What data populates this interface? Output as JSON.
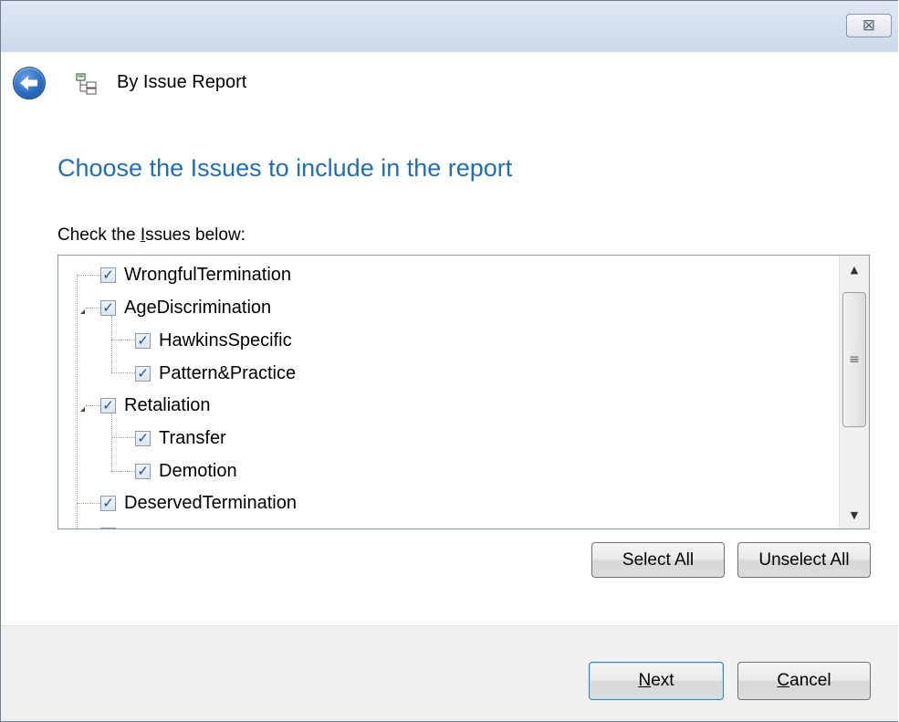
{
  "window": {
    "close_glyph": "⊠"
  },
  "header": {
    "title": "By Issue Report"
  },
  "page": {
    "heading": "Choose the Issues to include in the report",
    "check_label_pre": "Check the ",
    "check_label_acc": "I",
    "check_label_post": "ssues below:"
  },
  "tree": {
    "items": [
      {
        "label": "WrongfulTermination",
        "checked": true
      },
      {
        "label": "AgeDiscrimination",
        "checked": true
      },
      {
        "label": "HawkinsSpecific",
        "checked": true
      },
      {
        "label": "Pattern&Practice",
        "checked": true
      },
      {
        "label": "Retaliation",
        "checked": true
      },
      {
        "label": "Transfer",
        "checked": true
      },
      {
        "label": "Demotion",
        "checked": true
      },
      {
        "label": "DeservedTermination",
        "checked": true
      }
    ]
  },
  "buttons": {
    "select_all": "Select All",
    "unselect_all": "Unselect All",
    "next_acc": "N",
    "next_rest": "ext",
    "cancel_acc": "C",
    "cancel_rest": "ancel"
  },
  "icons": {
    "back": "back-arrow-icon",
    "wizard": "tree-report-icon",
    "checkmark": "✓"
  },
  "colors": {
    "heading": "#1e6fb5",
    "titlebar": "#cbd8ea",
    "footer": "#f0f0f0"
  }
}
